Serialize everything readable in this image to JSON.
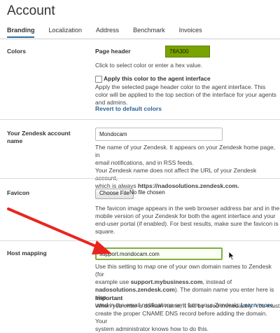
{
  "page": {
    "title": "Account"
  },
  "tabs": [
    {
      "label": "Branding",
      "active": true
    },
    {
      "label": "Localization",
      "active": false
    },
    {
      "label": "Address",
      "active": false
    },
    {
      "label": "Benchmark",
      "active": false
    },
    {
      "label": "Invoices",
      "active": false
    }
  ],
  "colors": {
    "section_label": "Colors",
    "page_header_label": "Page header",
    "page_header_value": "78A300",
    "page_header_color": "#78A300",
    "hint": "Click to select color or enter a hex value.",
    "apply_checkbox_label": "Apply this color to the agent interface",
    "apply_checkbox_checked": false,
    "apply_description": "Apply the selected page header color to the agent interface. This color will be applied to the top section of the interface for your agents and admins.",
    "revert_link": "Revert to default colors"
  },
  "account_name": {
    "section_label_line1": "Your Zendesk account",
    "section_label_line2": "name",
    "value": "Mondocam",
    "desc_line1": "The name of your Zendesk. It appears on your Zendesk home page, in",
    "desc_line2": "email notifications, and in RSS feeds.",
    "desc_line3": "Your Zendesk name does not affect the URL of your Zendesk account,",
    "desc_line4_prefix": "which is always ",
    "desc_line4_url": "https://nadosolutions.zendesk.com."
  },
  "favicon": {
    "section_label": "Favicon",
    "choose_button": "Choose File",
    "no_file_text": "No file chosen",
    "desc_line1": "The favicon image appears in the web browser address bar and in the",
    "desc_line2": "mobile version of your Zendesk for both the agent interface and your",
    "desc_line3": "end-user portal (if enabled). For best results, make sure the favicon is",
    "desc_line4": "square."
  },
  "host_mapping": {
    "section_label": "Host mapping",
    "value": "support.mondocam.com",
    "desc_line1": "Use this setting to map one of your own domain names to Zendesk (for",
    "desc_line2_prefix": "example use ",
    "desc_line2_bold": "support.mybusiness.com",
    "desc_line2_suffix": ", instead of",
    "desc_line3_bold": "nadosolutions.zendesk.com",
    "desc_line3_suffix": "). The domain name you enter here is also",
    "desc_line4_prefix": "used in the email notifications sent from your Zendesk. ",
    "desc_line4_link": "Learn more.",
    "important_label": "Important",
    "important_line1": "When you enter a domain name, it will be used immediately. You must",
    "important_line2": "create the proper CNAME DNS record before adding the domain. Your",
    "important_line3": "system administrator knows how to do this."
  },
  "annotation": {
    "arrow_color": "#E8261E"
  }
}
